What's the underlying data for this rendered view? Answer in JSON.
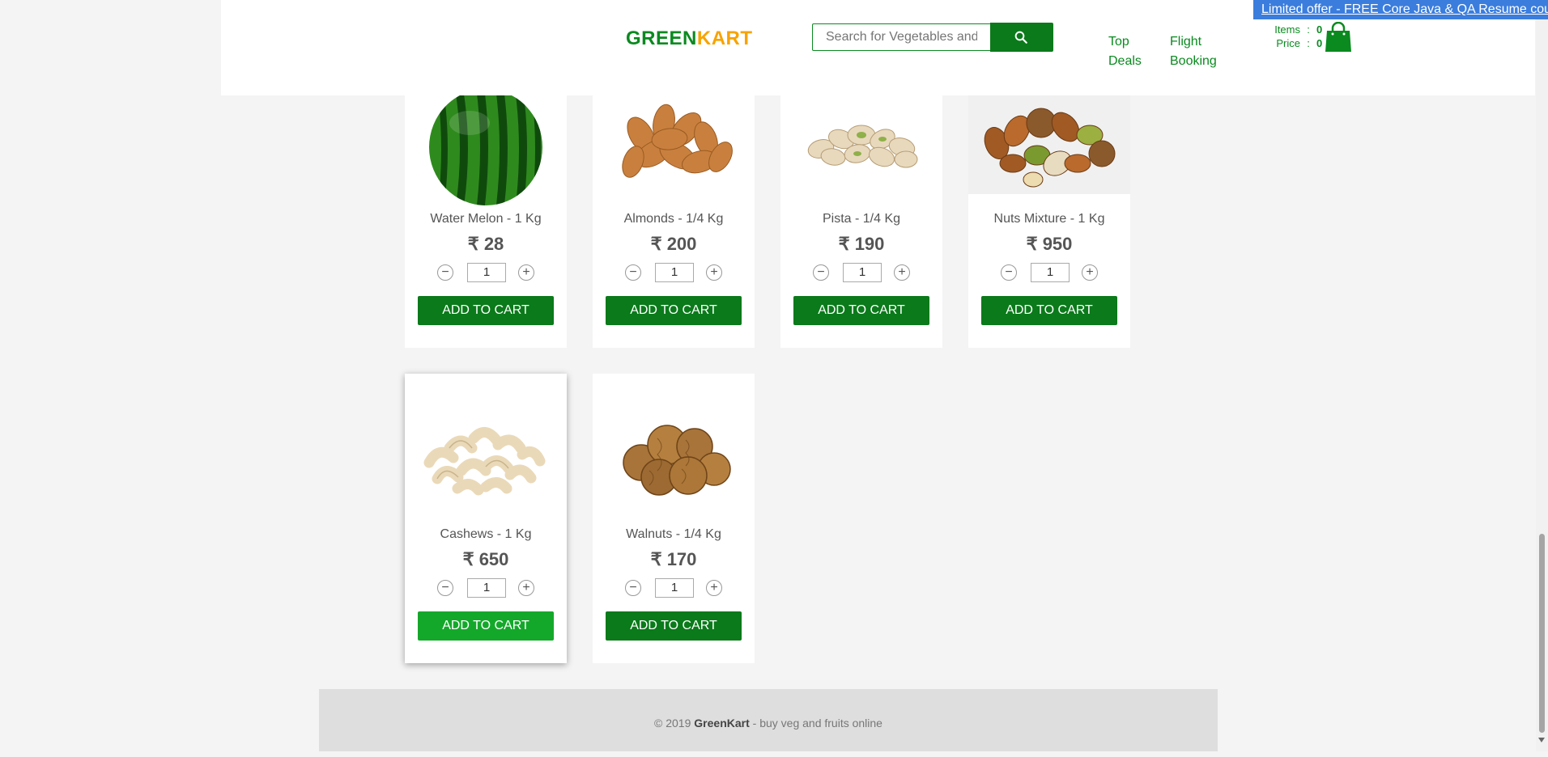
{
  "header": {
    "offer_text": "Limited offer - FREE Core Java & QA Resume course",
    "brand_green": "GREEN",
    "brand_kart": "KART",
    "search_placeholder": "Search for Vegetables and Fruits",
    "nav": {
      "top_deals": [
        "Top",
        "Deals"
      ],
      "flight_booking": [
        "Flight",
        "Booking"
      ]
    },
    "cart": {
      "items_label": "Items",
      "items_value": "0",
      "price_label": "Price",
      "price_value": "0",
      "sep": ":"
    }
  },
  "products": [
    {
      "name": "Water Melon - 1 Kg",
      "price": "₹ 28",
      "qty": "1",
      "add_label": "ADD TO CART"
    },
    {
      "name": "Almonds - 1/4 Kg",
      "price": "₹ 200",
      "qty": "1",
      "add_label": "ADD TO CART"
    },
    {
      "name": "Pista - 1/4 Kg",
      "price": "₹ 190",
      "qty": "1",
      "add_label": "ADD TO CART"
    },
    {
      "name": "Nuts Mixture - 1 Kg",
      "price": "₹ 950",
      "qty": "1",
      "add_label": "ADD TO CART"
    },
    {
      "name": "Cashews - 1 Kg",
      "price": "₹ 650",
      "qty": "1",
      "add_label": "ADD TO CART"
    },
    {
      "name": "Walnuts - 1/4 Kg",
      "price": "₹ 170",
      "qty": "1",
      "add_label": "ADD TO CART"
    }
  ],
  "stepper": {
    "minus": "−",
    "plus": "+"
  },
  "footer": {
    "copyright": "© 2019",
    "brand": "GreenKart",
    "tagline": "- buy veg and fruits online"
  },
  "colors": {
    "primary_green": "#0a7a1a",
    "hover_green": "#14a82a",
    "accent_orange": "#f7a300",
    "offer_blue": "#3b7ddd"
  }
}
